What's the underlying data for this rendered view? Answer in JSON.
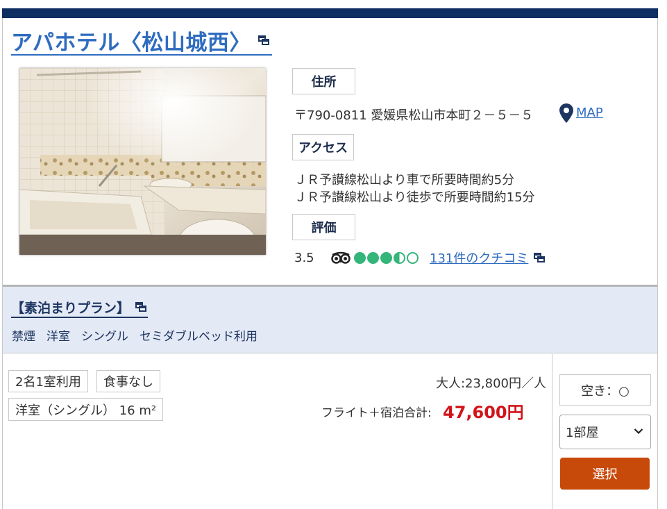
{
  "hotel": {
    "name": "アパホテル〈松山城西〉"
  },
  "info": {
    "address_label": "住所",
    "address": "〒790-0811 愛媛県松山市本町２－５－５",
    "map_label": "MAP",
    "access_label": "アクセス",
    "access_lines": [
      "ＪＲ予讃線松山より車で所要時間約5分",
      "ＪＲ予讃線松山より徒歩で所要時間約15分"
    ],
    "rating_label": "評価",
    "rating_score": "3.5",
    "rating_circles": 3.5,
    "reviews_link": "131件のクチコミ"
  },
  "plan": {
    "title": "【素泊まりプラン】",
    "tags": [
      "禁煙",
      "洋室",
      "シングル",
      "セミダブルベッド利用"
    ]
  },
  "room": {
    "occupancy": "2名1室利用",
    "meal": "食事なし",
    "room_type": "洋室（シングル） 16 m²",
    "adult_price": "大人:23,800円／人",
    "total_label": "フライト＋宿泊合計:",
    "total_price": "47,600円",
    "availability": "空き：○",
    "room_count_selected": "1部屋",
    "select_button": "選択"
  },
  "colors": {
    "topbar": "#0f2f63",
    "link": "#2f6cc0",
    "price": "#d2141a",
    "button": "#c84a0b",
    "band": "#e3e9f5",
    "rating_green": "#34b57a"
  }
}
